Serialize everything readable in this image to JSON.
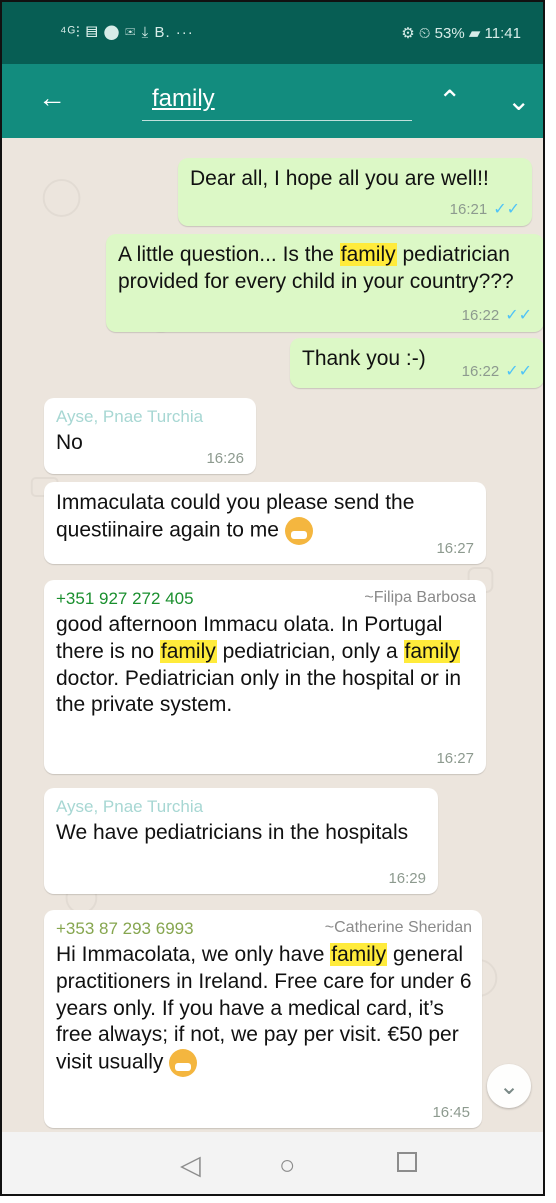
{
  "status_bar": {
    "left_icons": "⁴ᴳ⫶ ▤ ⬤ ✉ ⤓ B. ···",
    "right_text": "⚙ ⏲ 53% ▰ 11:41"
  },
  "toolbar": {
    "search_value": "family",
    "back_icon": "arrow-left-icon",
    "up_icon": "chevron-up-icon",
    "down_icon": "chevron-down-icon"
  },
  "messages": [
    {
      "id": "m1",
      "kind": "out",
      "text": "Dear all, I hope all you are well!!",
      "time": "16:21",
      "ticks": "✓✓"
    },
    {
      "id": "m2",
      "kind": "out",
      "segments": [
        "A little question... Is the ",
        "family",
        " pediatrician  provided for every child in your country???"
      ],
      "time": "16:22",
      "ticks": "✓✓"
    },
    {
      "id": "m3",
      "kind": "out",
      "text": "Thank you :-)",
      "time": "16:22",
      "ticks": "✓✓"
    },
    {
      "id": "m4",
      "kind": "in",
      "sender": "Ayse, Pnae Turchia",
      "sender_color": "#A7D7D3",
      "text": "No",
      "time": "16:26"
    },
    {
      "id": "m5",
      "kind": "in",
      "text": "Immaculata could you please send the questiinaire again to me",
      "emoji": "see-no-evil-monkey-emoji",
      "time": "16:27"
    },
    {
      "id": "m6",
      "kind": "in",
      "sender": "+351 927 272 405",
      "sender_color": "#1A8F2E",
      "sender_aka": "~Filipa Barbosa",
      "segments": [
        "good afternoon Immacu olata. In Portugal there is no ",
        "family",
        " pediatrician, only a ",
        "family",
        " doctor. Pediatrician only in the hospital or in the private system."
      ],
      "time": "16:27"
    },
    {
      "id": "m7",
      "kind": "in",
      "sender": "Ayse, Pnae Turchia",
      "sender_color": "#A7D7D3",
      "text": "We have pediatricians in the hospitals",
      "time": "16:29"
    },
    {
      "id": "m8",
      "kind": "in",
      "sender": "+353 87 293 6993",
      "sender_color": "#86A64F",
      "sender_aka": "~Catherine Sheridan",
      "segments": [
        "Hi Immacolata, we only have ",
        "family",
        " general practitioners in Ireland. Free care for under 6 years only. If you have a medical card, it’s free always; if not, we pay per visit. €50 per visit usually"
      ],
      "emoji": "face-mask-emoji",
      "time": "16:45"
    }
  ],
  "nav": {
    "back_icon": "nav-back-icon",
    "home_icon": "nav-home-icon",
    "recents_icon": "nav-recents-icon"
  },
  "colors": {
    "header_dark": "#075E54",
    "header": "#128C7E",
    "chat_bg": "#ECE5DD",
    "outgoing": "#DCF8C6",
    "incoming": "#FFFFFF",
    "highlight": "#FFEB3B",
    "read_ticks": "#4FC3F7"
  }
}
